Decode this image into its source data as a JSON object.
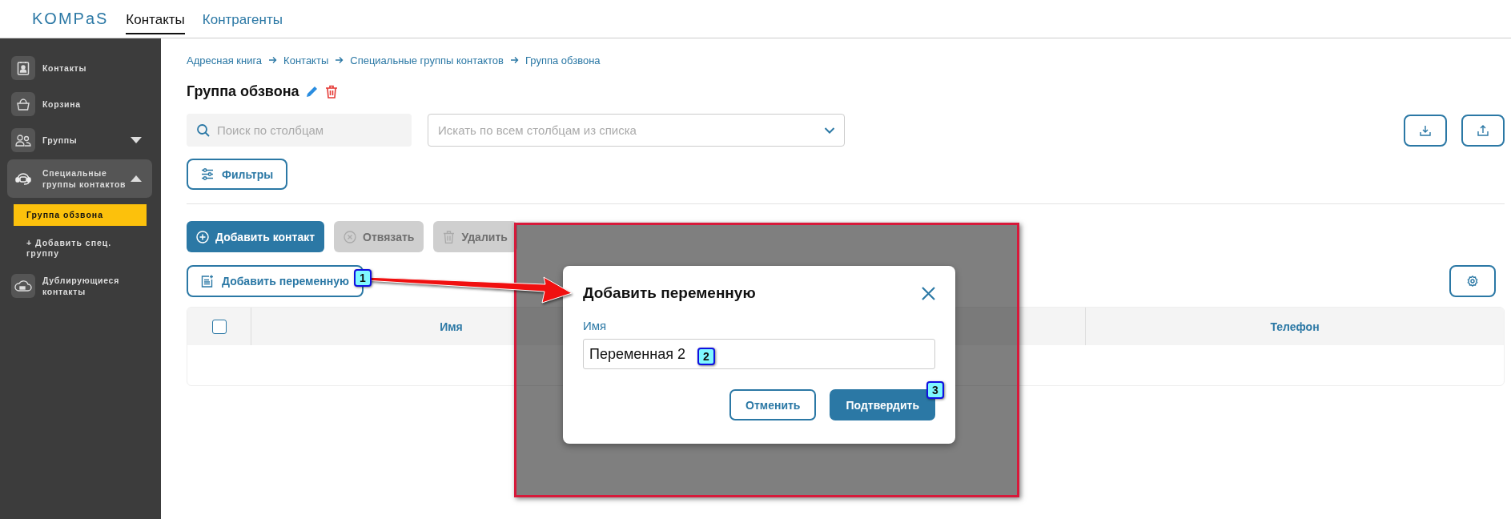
{
  "header": {
    "logo": "KOMPaS",
    "tabs": [
      {
        "label": "Контакты",
        "selected": true
      },
      {
        "label": "Контрагенты",
        "selected": false
      }
    ]
  },
  "sidebar": {
    "items": [
      {
        "label": "Контакты",
        "selected": false
      },
      {
        "label": "Корзина",
        "selected": false
      },
      {
        "label": "Группы",
        "selected": false,
        "expanded": false
      },
      {
        "label": "Специальные группы контактов",
        "selected": true,
        "expanded": true,
        "children": [
          {
            "label": "Группа обзвона",
            "selected": true
          },
          {
            "label": "+ Добавить спец. группу",
            "selected": false
          }
        ]
      },
      {
        "label": "Дублирующиеся контакты",
        "selected": false
      }
    ]
  },
  "breadcrumbs": [
    "Адресная книга",
    "Контакты",
    "Специальные группы контактов",
    "Группа обзвона"
  ],
  "title": "Группа обзвона",
  "search": {
    "placeholder": "Поиск по столбцам"
  },
  "column_filter": {
    "placeholder": "Искать по всем столбцам из списка"
  },
  "filters_button": "Фильтры",
  "actions": [
    {
      "label": "Добавить контакт",
      "disabled": false
    },
    {
      "label": "Отвязать",
      "disabled": true
    },
    {
      "label": "Удалить",
      "disabled": true
    }
  ],
  "add_variable_button": "Добавить переменную",
  "table": {
    "select_all_checked": false,
    "columns": [
      {
        "label": "Имя"
      },
      {
        "label": "Телефон"
      }
    ]
  },
  "dialog": {
    "title": "Добавить переменную",
    "field_label": "Имя",
    "value": "Переменная 2",
    "buttons": [
      {
        "label": "Отменить",
        "kind": "secondary"
      },
      {
        "label": "Подтвердить",
        "kind": "primary"
      }
    ]
  },
  "annotations": [
    {
      "number": "1"
    },
    {
      "number": "2"
    },
    {
      "number": "3"
    }
  ]
}
